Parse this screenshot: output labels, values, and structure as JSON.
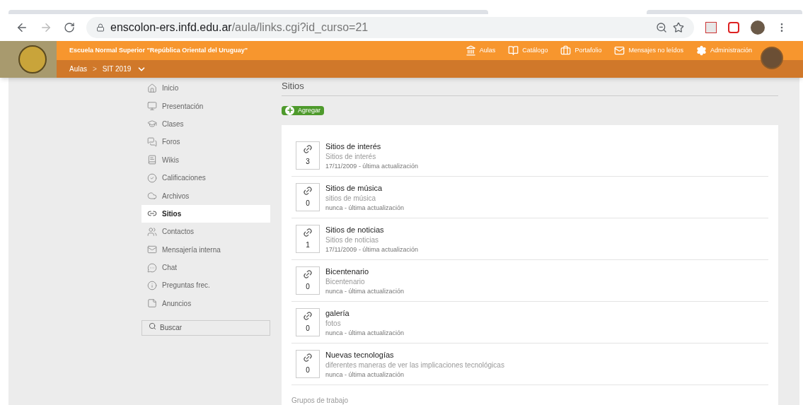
{
  "browser": {
    "url_host": "enscolon-ers.infd.edu.ar",
    "url_path": "/aula/links.cgi?id_curso=21"
  },
  "header": {
    "school": "Escuela Normal Superior \"República Oriental del Uruguay\"",
    "nav": [
      {
        "label": "Aulas"
      },
      {
        "label": "Catálogo"
      },
      {
        "label": "Portafolio"
      },
      {
        "label": "Mensajes no leídos"
      },
      {
        "label": "Administración"
      }
    ],
    "breadcrumb": {
      "root": "Aulas",
      "separator": ">",
      "current": "SIT 2019"
    }
  },
  "sidebar": {
    "items": [
      {
        "label": "Inicio",
        "selected": false
      },
      {
        "label": "Presentación",
        "selected": false
      },
      {
        "label": "Clases",
        "selected": false
      },
      {
        "label": "Foros",
        "selected": false
      },
      {
        "label": "Wikis",
        "selected": false
      },
      {
        "label": "Calificaciones",
        "selected": false
      },
      {
        "label": "Archivos",
        "selected": false
      },
      {
        "label": "Sitios",
        "selected": true
      },
      {
        "label": "Contactos",
        "selected": false
      },
      {
        "label": "Mensajería interna",
        "selected": false
      },
      {
        "label": "Chat",
        "selected": false
      },
      {
        "label": "Preguntas frec.",
        "selected": false
      },
      {
        "label": "Anuncios",
        "selected": false
      }
    ],
    "search": {
      "placeholder": "Buscar"
    }
  },
  "main": {
    "heading": "Sitios",
    "add_button": "Agregar",
    "links": [
      {
        "title": "Sitios de interés",
        "description": "Sitios de interés",
        "updated": "17/11/2009 - última actualización",
        "count": "3"
      },
      {
        "title": "Sitios de música",
        "description": "sitios de música",
        "updated": "nunca - última actualización",
        "count": "0"
      },
      {
        "title": "Sitios de noticias",
        "description": "Sitios de noticias",
        "updated": "17/11/2009 - última actualización",
        "count": "1"
      },
      {
        "title": "Bicentenario",
        "description": "Bicentenario",
        "updated": "nunca - última actualización",
        "count": "0"
      },
      {
        "title": "galería",
        "description": "fotos",
        "updated": "nunca - última actualización",
        "count": "0"
      },
      {
        "title": "Nuevas tecnologías",
        "description": "diferentes maneras de ver las implicaciones tecnológicas",
        "updated": "nunca - última actualización",
        "count": "0"
      }
    ],
    "section": "Grupos de trabajo"
  }
}
